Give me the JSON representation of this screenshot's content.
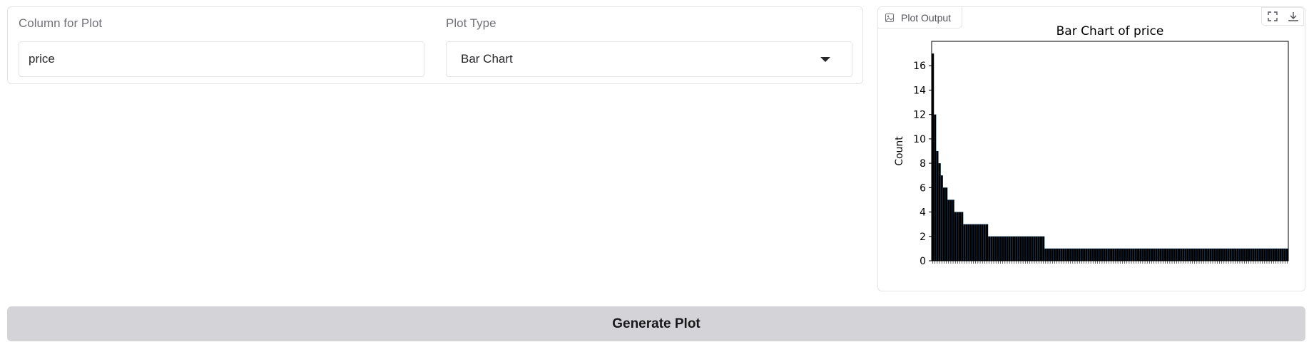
{
  "inputs": {
    "column_label": "Column for Plot",
    "column_value": "price",
    "plot_type_label": "Plot Type",
    "plot_type_value": "Bar Chart"
  },
  "output": {
    "tab_label": "Plot Output",
    "fullscreen_icon": "fullscreen-icon",
    "download_icon": "download-icon"
  },
  "button": {
    "generate_label": "Generate Plot"
  },
  "colors": {
    "bar_fill": "#000000",
    "bar_edge": "#1f77b4",
    "button_bg": "#d4d4d8"
  },
  "chart_data": {
    "type": "bar",
    "title": "Bar Chart of price",
    "xlabel": "",
    "ylabel": "Count",
    "ylim": [
      0,
      18
    ],
    "yticks": [
      0,
      2,
      4,
      6,
      8,
      10,
      12,
      14,
      16
    ],
    "grid": false,
    "values": [
      17,
      12,
      9,
      8,
      7,
      6,
      6,
      5,
      5,
      5,
      4,
      4,
      4,
      4,
      3,
      3,
      3,
      3,
      3,
      3,
      3,
      3,
      3,
      3,
      3,
      2,
      2,
      2,
      2,
      2,
      2,
      2,
      2,
      2,
      2,
      2,
      2,
      2,
      2,
      2,
      2,
      2,
      2,
      2,
      2,
      2,
      2,
      2,
      2,
      2,
      1,
      1,
      1,
      1,
      1,
      1,
      1,
      1,
      1,
      1,
      1,
      1,
      1,
      1,
      1,
      1,
      1,
      1,
      1,
      1,
      1,
      1,
      1,
      1,
      1,
      1,
      1,
      1,
      1,
      1,
      1,
      1,
      1,
      1,
      1,
      1,
      1,
      1,
      1,
      1,
      1,
      1,
      1,
      1,
      1,
      1,
      1,
      1,
      1,
      1,
      1,
      1,
      1,
      1,
      1,
      1,
      1,
      1,
      1,
      1,
      1,
      1,
      1,
      1,
      1,
      1,
      1,
      1,
      1,
      1,
      1,
      1,
      1,
      1,
      1,
      1,
      1,
      1,
      1,
      1,
      1,
      1,
      1,
      1,
      1,
      1,
      1,
      1,
      1,
      1,
      1,
      1,
      1,
      1,
      1,
      1,
      1,
      1,
      1,
      1,
      1,
      1,
      1,
      1,
      1,
      1,
      1,
      1
    ]
  }
}
